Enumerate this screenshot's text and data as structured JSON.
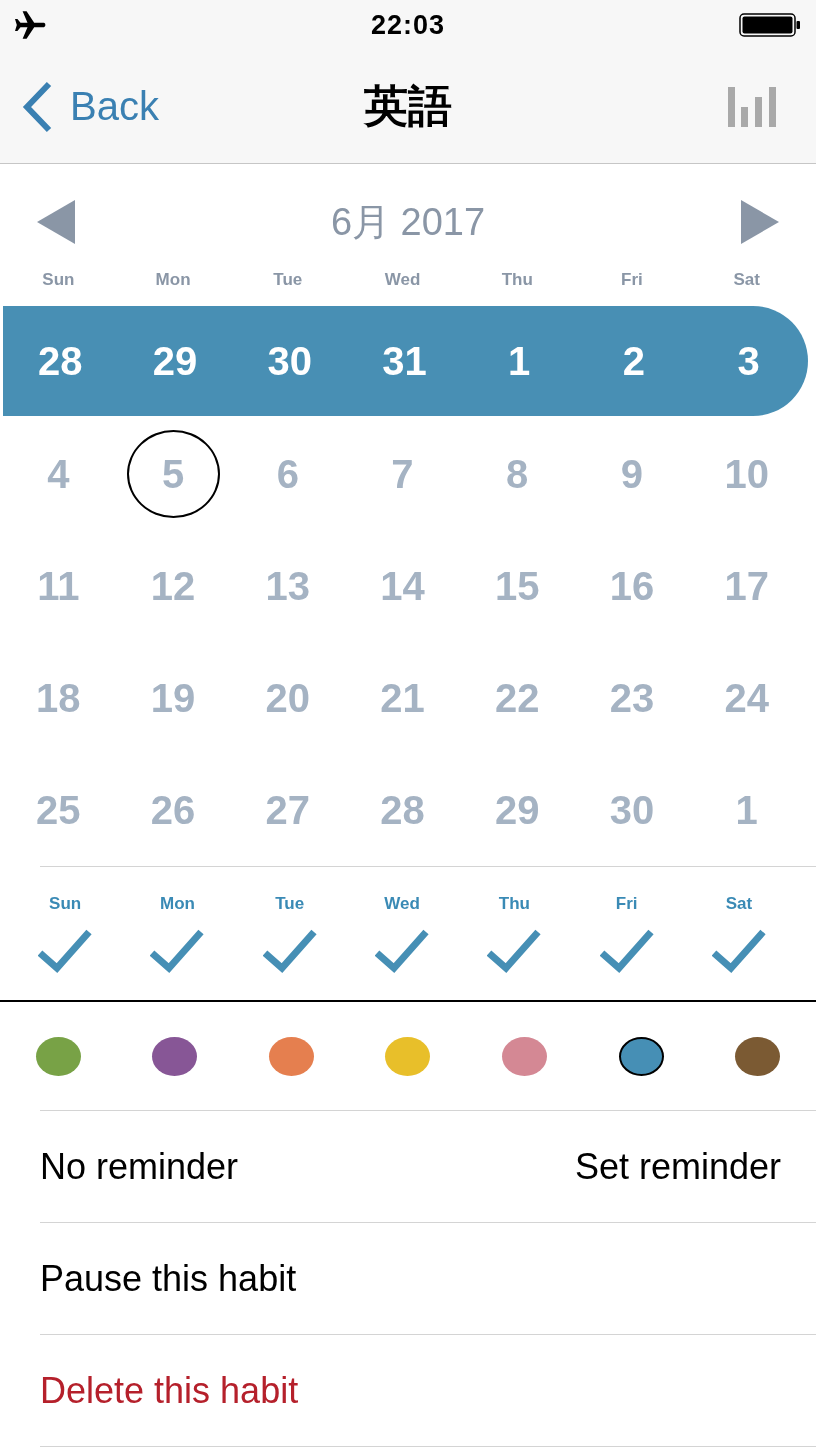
{
  "status_bar": {
    "time": "22:03"
  },
  "nav": {
    "back_label": "Back",
    "title": "英語"
  },
  "calendar": {
    "month_label": "6月 2017",
    "weekdays": [
      "Sun",
      "Mon",
      "Tue",
      "Wed",
      "Thu",
      "Fri",
      "Sat"
    ],
    "weeks": [
      {
        "selected": true,
        "days": [
          {
            "label": "28",
            "today": false
          },
          {
            "label": "29",
            "today": false
          },
          {
            "label": "30",
            "today": false
          },
          {
            "label": "31",
            "today": false
          },
          {
            "label": "1",
            "today": false
          },
          {
            "label": "2",
            "today": false
          },
          {
            "label": "3",
            "today": false
          }
        ]
      },
      {
        "selected": false,
        "days": [
          {
            "label": "4",
            "today": false
          },
          {
            "label": "5",
            "today": true
          },
          {
            "label": "6",
            "today": false
          },
          {
            "label": "7",
            "today": false
          },
          {
            "label": "8",
            "today": false
          },
          {
            "label": "9",
            "today": false
          },
          {
            "label": "10",
            "today": false
          }
        ]
      },
      {
        "selected": false,
        "days": [
          {
            "label": "11",
            "today": false
          },
          {
            "label": "12",
            "today": false
          },
          {
            "label": "13",
            "today": false
          },
          {
            "label": "14",
            "today": false
          },
          {
            "label": "15",
            "today": false
          },
          {
            "label": "16",
            "today": false
          },
          {
            "label": "17",
            "today": false
          }
        ]
      },
      {
        "selected": false,
        "days": [
          {
            "label": "18",
            "today": false
          },
          {
            "label": "19",
            "today": false
          },
          {
            "label": "20",
            "today": false
          },
          {
            "label": "21",
            "today": false
          },
          {
            "label": "22",
            "today": false
          },
          {
            "label": "23",
            "today": false
          },
          {
            "label": "24",
            "today": false
          }
        ]
      },
      {
        "selected": false,
        "days": [
          {
            "label": "25",
            "today": false
          },
          {
            "label": "26",
            "today": false
          },
          {
            "label": "27",
            "today": false
          },
          {
            "label": "28",
            "today": false
          },
          {
            "label": "29",
            "today": false
          },
          {
            "label": "30",
            "today": false
          },
          {
            "label": "1",
            "today": false
          }
        ]
      }
    ]
  },
  "repeat_days": [
    {
      "label": "Sun",
      "checked": true
    },
    {
      "label": "Mon",
      "checked": true
    },
    {
      "label": "Tue",
      "checked": true
    },
    {
      "label": "Wed",
      "checked": true
    },
    {
      "label": "Thu",
      "checked": true
    },
    {
      "label": "Fri",
      "checked": true
    },
    {
      "label": "Sat",
      "checked": true
    }
  ],
  "colors": [
    {
      "color": "#78a246",
      "selected": false
    },
    {
      "color": "#875696",
      "selected": false
    },
    {
      "color": "#e57f4f",
      "selected": false
    },
    {
      "color": "#e8bf2a",
      "selected": false
    },
    {
      "color": "#d48894",
      "selected": false
    },
    {
      "color": "#468fb5",
      "selected": true
    },
    {
      "color": "#7b5a33",
      "selected": false
    }
  ],
  "reminder": {
    "status": "No reminder",
    "action": "Set reminder"
  },
  "actions": [
    {
      "label": "Pause this habit",
      "kind": "normal"
    },
    {
      "label": "Delete this habit",
      "kind": "destructive"
    }
  ]
}
